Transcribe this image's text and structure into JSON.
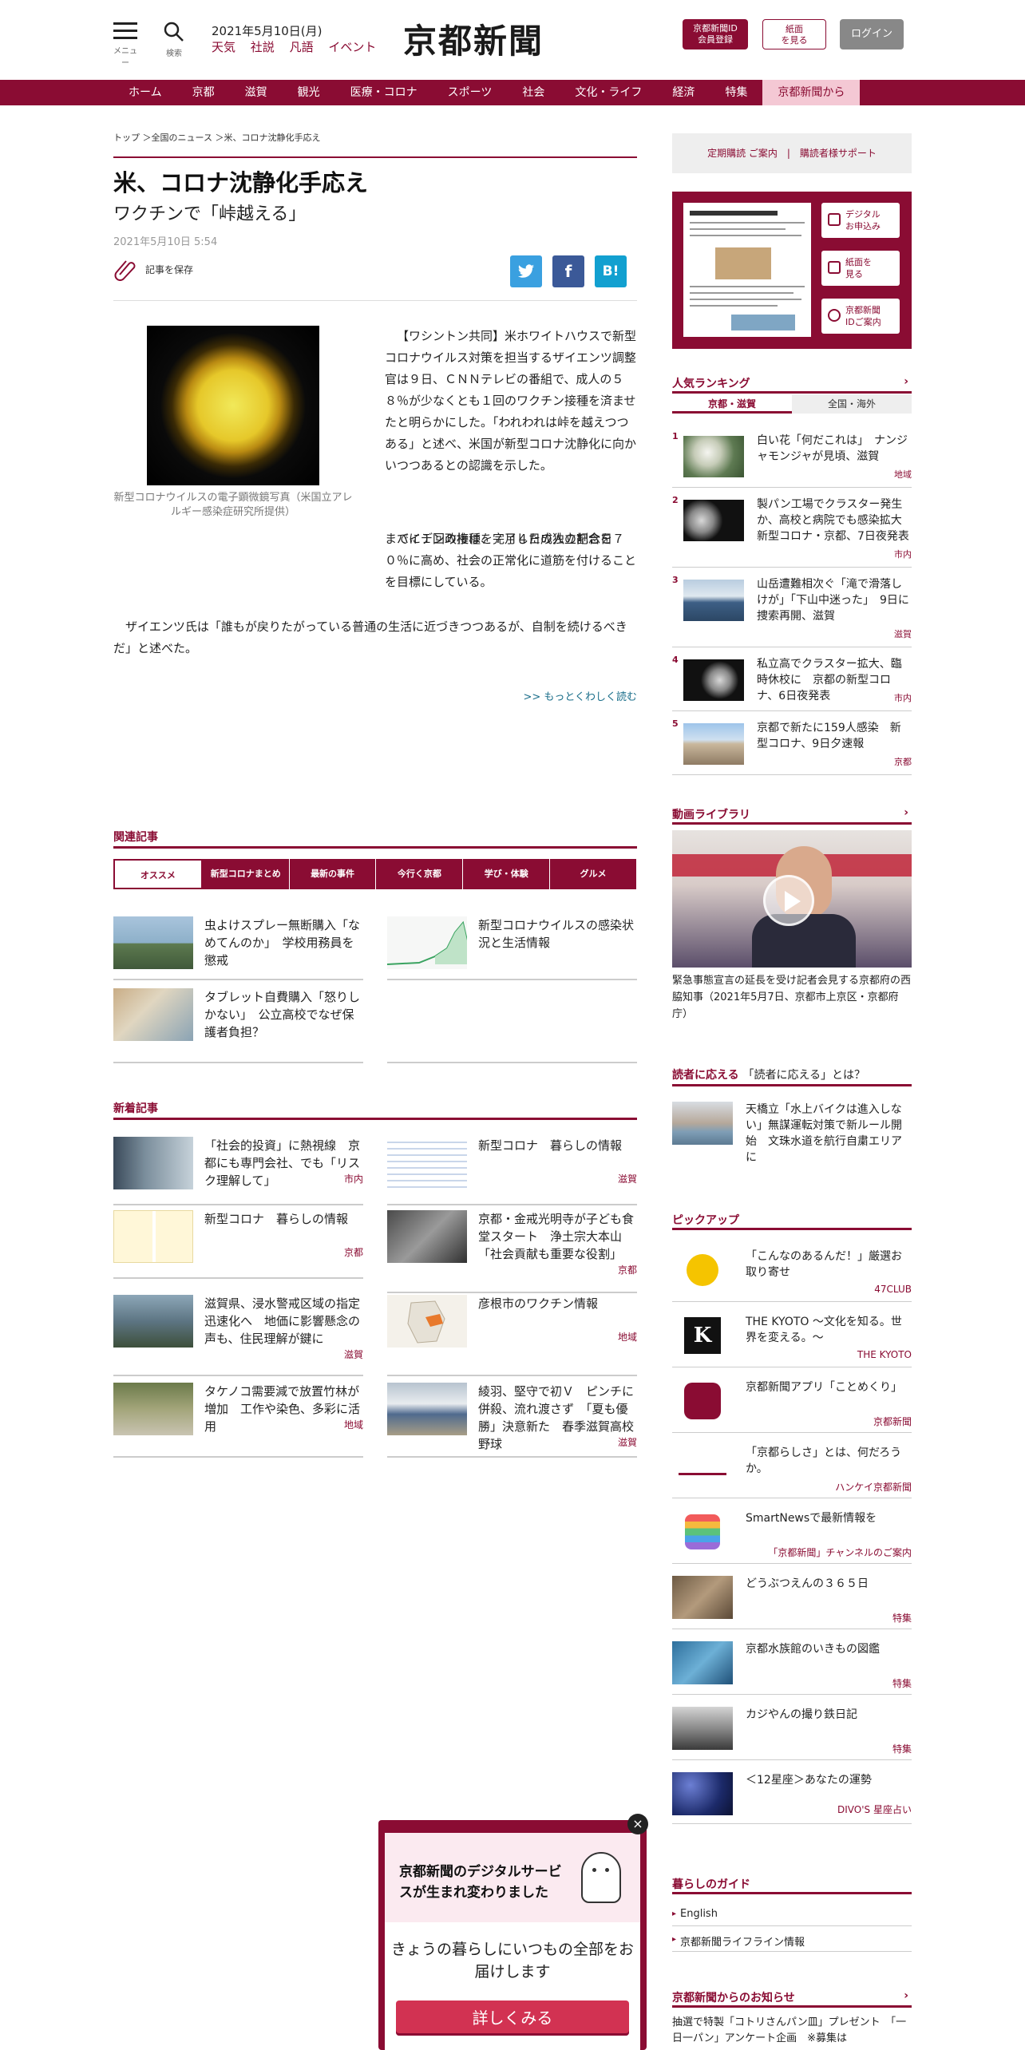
{
  "header": {
    "menu_label": "メニュー",
    "search_label": "検索",
    "date": "2021年5月10日(月)",
    "links": [
      "天気",
      "社説",
      "凡語",
      "イベント"
    ],
    "logo": "京都新聞",
    "id_button": "京都新聞ID\n会員登録",
    "paper_button": "紙面\nを見る",
    "login_button": "ログイン"
  },
  "nav": [
    "ホーム",
    "京都",
    "滋賀",
    "観光",
    "医療・コロナ",
    "スポーツ",
    "社会",
    "文化・ライフ",
    "経済",
    "特集",
    "京都新聞から"
  ],
  "article": {
    "breadcrumb": "トップ ＞全国のニュース ＞米、コロナ沈静化手応え",
    "title": "米、コロナ沈静化手応え",
    "subtitle": "ワクチンで「峠越える」",
    "date": "2021年5月10日 5:54",
    "save": "記事を保存",
    "share_tw": "",
    "share_fb": "f",
    "share_hb": "B!",
    "photo_caption": "新型コロナウイルスの電子顕微鏡写真（米国立アレルギー感染症研究所提供）",
    "p1": "【ワシントン共同】米ホワイトハウスで新型コロナウイルス対策を担当するザイエンツ調整官は９日、ＣＮＮテレビの番組で、成人の５８％が少なくとも１回のワクチン接種を済ませたと明らかにした。「われわれは峠を越えつつある」と述べ、米国が新型コロナ沈静化に向かいつつあるとの認識を示した。",
    "p2a": "バイデン政権は、７月４日の独立記念日",
    "p2b": "までに１回の接種を完了した成人の割合を７０％に高め、社会の正常化に道筋を付けることを目標にしている。",
    "p3": "ザイエンツ氏は「誰もが戻りたがっている普通の生活に近づきつつあるが、自制を続けるべきだ」と述べた。",
    "readmore": ">> もっとくわしく読む"
  },
  "related": {
    "title": "関連記事",
    "tabs": [
      "オススメ",
      "新型コロナまとめ",
      "最新の事件",
      "今行く京都",
      "学び・体験",
      "グルメ"
    ],
    "items": [
      {
        "title": "虫よけスプレー無断購入「なめてんのか」　学校用務員を懲戒"
      },
      {
        "title": "新型コロナウイルスの感染状況と生活情報"
      },
      {
        "title": "タブレット自費購入「怒りしかない」　公立高校でなぜ保護者負担？"
      }
    ]
  },
  "latest": {
    "title": "新着記事",
    "items": [
      {
        "title": "「社会的投資」に熱視線　京都にも専門会社、でも「リスク理解して」",
        "tag": "市内"
      },
      {
        "title": "新型コロナ　暮らしの情報",
        "tag": "滋賀"
      },
      {
        "title": "新型コロナ　暮らしの情報",
        "tag": "京都"
      },
      {
        "title": "京都・金戒光明寺が子ども食堂スタート　浄土宗大本山「社会貢献も重要な役割」",
        "tag": "京都"
      },
      {
        "title": "滋賀県、浸水警戒区域の指定迅速化へ　地価に影響懸念の声も、住民理解が鍵に",
        "tag": "滋賀"
      },
      {
        "title": "彦根市のワクチン情報",
        "tag": "地域"
      },
      {
        "title": "タケノコ需要減で放置竹林が増加　工作や染色、多彩に活用",
        "tag": "地域"
      },
      {
        "title": "綾羽、堅守で初Ｖ　ピンチに併殺、流れ渡さず　「夏も優勝」決意新た　春季滋賀高校野球",
        "tag": "滋賀"
      }
    ]
  },
  "sidebar": {
    "subscribe": "定期購読 ご案内　|　購読者様サポート",
    "paper_buttons": [
      "デジタル\nお申込み",
      "紙面を\n見る",
      "京都新聞\nIDご案内"
    ],
    "ranking_title": "人気ランキング",
    "ranking_tabs": [
      "京都・滋賀",
      "全国・海外"
    ],
    "ranking": [
      {
        "num": "1",
        "title": "白い花「何だこれは」　ナンジャモンジャが見頃、滋賀",
        "tag": "地域"
      },
      {
        "num": "2",
        "title": "製パン工場でクラスター発生か、高校と病院でも感染拡大　新型コロナ・京都、7日夜発表",
        "tag": "市内"
      },
      {
        "num": "3",
        "title": "山岳遭難相次ぐ「滝で滑落しけが」「下山中迷った」　9日に捜索再開、滋賀",
        "tag": "滋賀"
      },
      {
        "num": "4",
        "title": "私立高でクラスター拡大、臨時休校に　京都の新型コロナ、6日夜発表",
        "tag": "市内"
      },
      {
        "num": "5",
        "title": "京都で新たに159人感染　新型コロナ、9日夕速報",
        "tag": "京都"
      }
    ],
    "video_title": "動画ライブラリ",
    "video_caption": "緊急事態宣言の延長を受け記者会見する京都府の西脇知事（2021年5月7日、京都市上京区・京都府庁）",
    "reader_title": "読者に応える",
    "reader_title2": "「読者に応える」とは？",
    "reader_item": "天橋立「水上バイクは進入しない」無謀運転対策で新ルール開始　文珠水道を航行自粛エリアに",
    "pickup_title": "ピックアップ",
    "pickup": [
      {
        "title": "「こんなのあるんだ！」厳選お取り寄せ",
        "tag": "47CLUB"
      },
      {
        "title": "THE KYOTO ～文化を知る。世界を変える。～",
        "tag": "THE KYOTO"
      },
      {
        "title": "京都新聞アプリ「ことめくり」",
        "tag": "京都新聞"
      },
      {
        "title": "「京都らしさ」とは、何だろうか。",
        "tag": "ハンケイ京都新聞"
      },
      {
        "title": "SmartNewsで最新情報を",
        "tag": "「京都新聞」チャンネルのご案内"
      },
      {
        "title": "どうぶつえんの３６５日",
        "tag": "特集"
      },
      {
        "title": "京都水族館のいきもの図鑑",
        "tag": "特集"
      },
      {
        "title": "カジやんの撮り鉄日記",
        "tag": "特集"
      },
      {
        "title": "＜12星座＞あなたの運勢",
        "tag": "DIVO'S 星座占い"
      }
    ],
    "guide_title": "暮らしのガイド",
    "guide": [
      "English",
      "京都新聞ライフライン情報"
    ],
    "notice_title": "京都新聞からのお知らせ",
    "notice": "抽選で特製「コトリさんパン皿」プレゼント　「一日一パン」アンケート企画　※募集は"
  },
  "popup": {
    "title": "京都新聞のデジタルサービスが生まれ変わりました",
    "subtitle": "きょうの暮らしにいつもの全部をお届けします",
    "button": "詳しくみる",
    "close": "×"
  }
}
